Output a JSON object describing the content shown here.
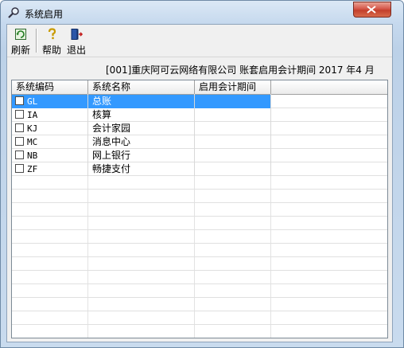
{
  "window": {
    "title": "系统启用",
    "close_icon": "close-icon"
  },
  "toolbar": {
    "buttons": [
      {
        "label": "刷新",
        "icon": "refresh-icon"
      },
      {
        "label": "帮助",
        "icon": "help-icon"
      },
      {
        "label": "退出",
        "icon": "exit-icon"
      }
    ]
  },
  "info": {
    "company": "[001]重庆阿可云网络有限公司",
    "period_text": "账套启用会计期间 2017 年4 月"
  },
  "table": {
    "columns": [
      "系统编码",
      "系统名称",
      "启用会计期间"
    ],
    "rows": [
      {
        "code": "GL",
        "name": "总账",
        "period": "",
        "checked": false,
        "selected": true
      },
      {
        "code": "IA",
        "name": "核算",
        "period": "",
        "checked": false,
        "selected": false
      },
      {
        "code": "KJ",
        "name": "会计家园",
        "period": "",
        "checked": false,
        "selected": false
      },
      {
        "code": "MC",
        "name": "消息中心",
        "period": "",
        "checked": false,
        "selected": false
      },
      {
        "code": "NB",
        "name": "网上银行",
        "period": "",
        "checked": false,
        "selected": false
      },
      {
        "code": "ZF",
        "name": "畅捷支付",
        "period": "",
        "checked": false,
        "selected": false
      }
    ]
  },
  "colors": {
    "selection": "#3399ff",
    "close_button": "#c9493a"
  }
}
